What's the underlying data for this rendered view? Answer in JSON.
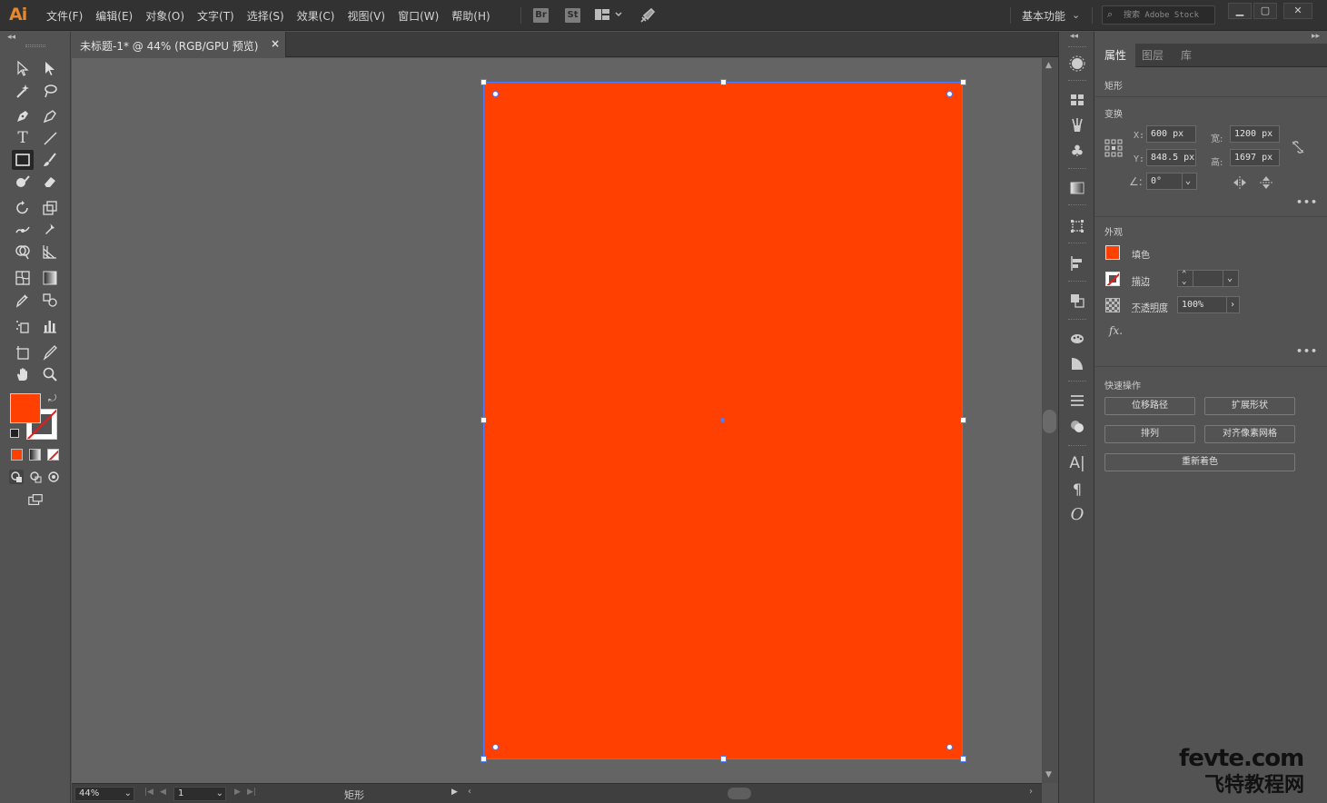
{
  "app": {
    "logo": "Ai"
  },
  "menu": [
    "文件(F)",
    "编辑(E)",
    "对象(O)",
    "文字(T)",
    "选择(S)",
    "效果(C)",
    "视图(V)",
    "窗口(W)",
    "帮助(H)"
  ],
  "menubar": {
    "bridge_badge": "Br",
    "stock_badge": "St",
    "workspace": "基本功能",
    "stock_search_placeholder": "搜索 Adobe Stock"
  },
  "document": {
    "tab_title": "未标题-1* @ 44% (RGB/GPU 预览)",
    "close_glyph": "×",
    "artboard_color": "#ff4000",
    "selection_color": "#4a7dff"
  },
  "statusbar": {
    "zoom": "44%",
    "page": "1",
    "object_type": "矩形"
  },
  "colors": {
    "fill": "#ff4000",
    "stroke": "none"
  },
  "properties": {
    "tabs": [
      "属性",
      "图层",
      "库"
    ],
    "object_type": "矩形",
    "transform": {
      "label": "变换",
      "x_label": "X:",
      "x": "600 px",
      "y_label": "Y:",
      "y": "848.5 px",
      "w_label": "宽:",
      "w": "1200 px",
      "h_label": "高:",
      "h": "1697 px",
      "angle": "0°"
    },
    "appearance": {
      "label": "外观",
      "fill_label": "填色",
      "stroke_label": "描边",
      "opacity_label": "不透明度",
      "opacity": "100%",
      "fx": "fx."
    },
    "quick_actions": {
      "label": "快速操作",
      "offset_path": "位移路径",
      "expand_shape": "扩展形状",
      "arrange": "排列",
      "align_pixel_grid": "对齐像素网格",
      "recolor": "重新着色"
    }
  },
  "watermark": {
    "line1": "fevte.com",
    "line2": "飞特教程网"
  }
}
